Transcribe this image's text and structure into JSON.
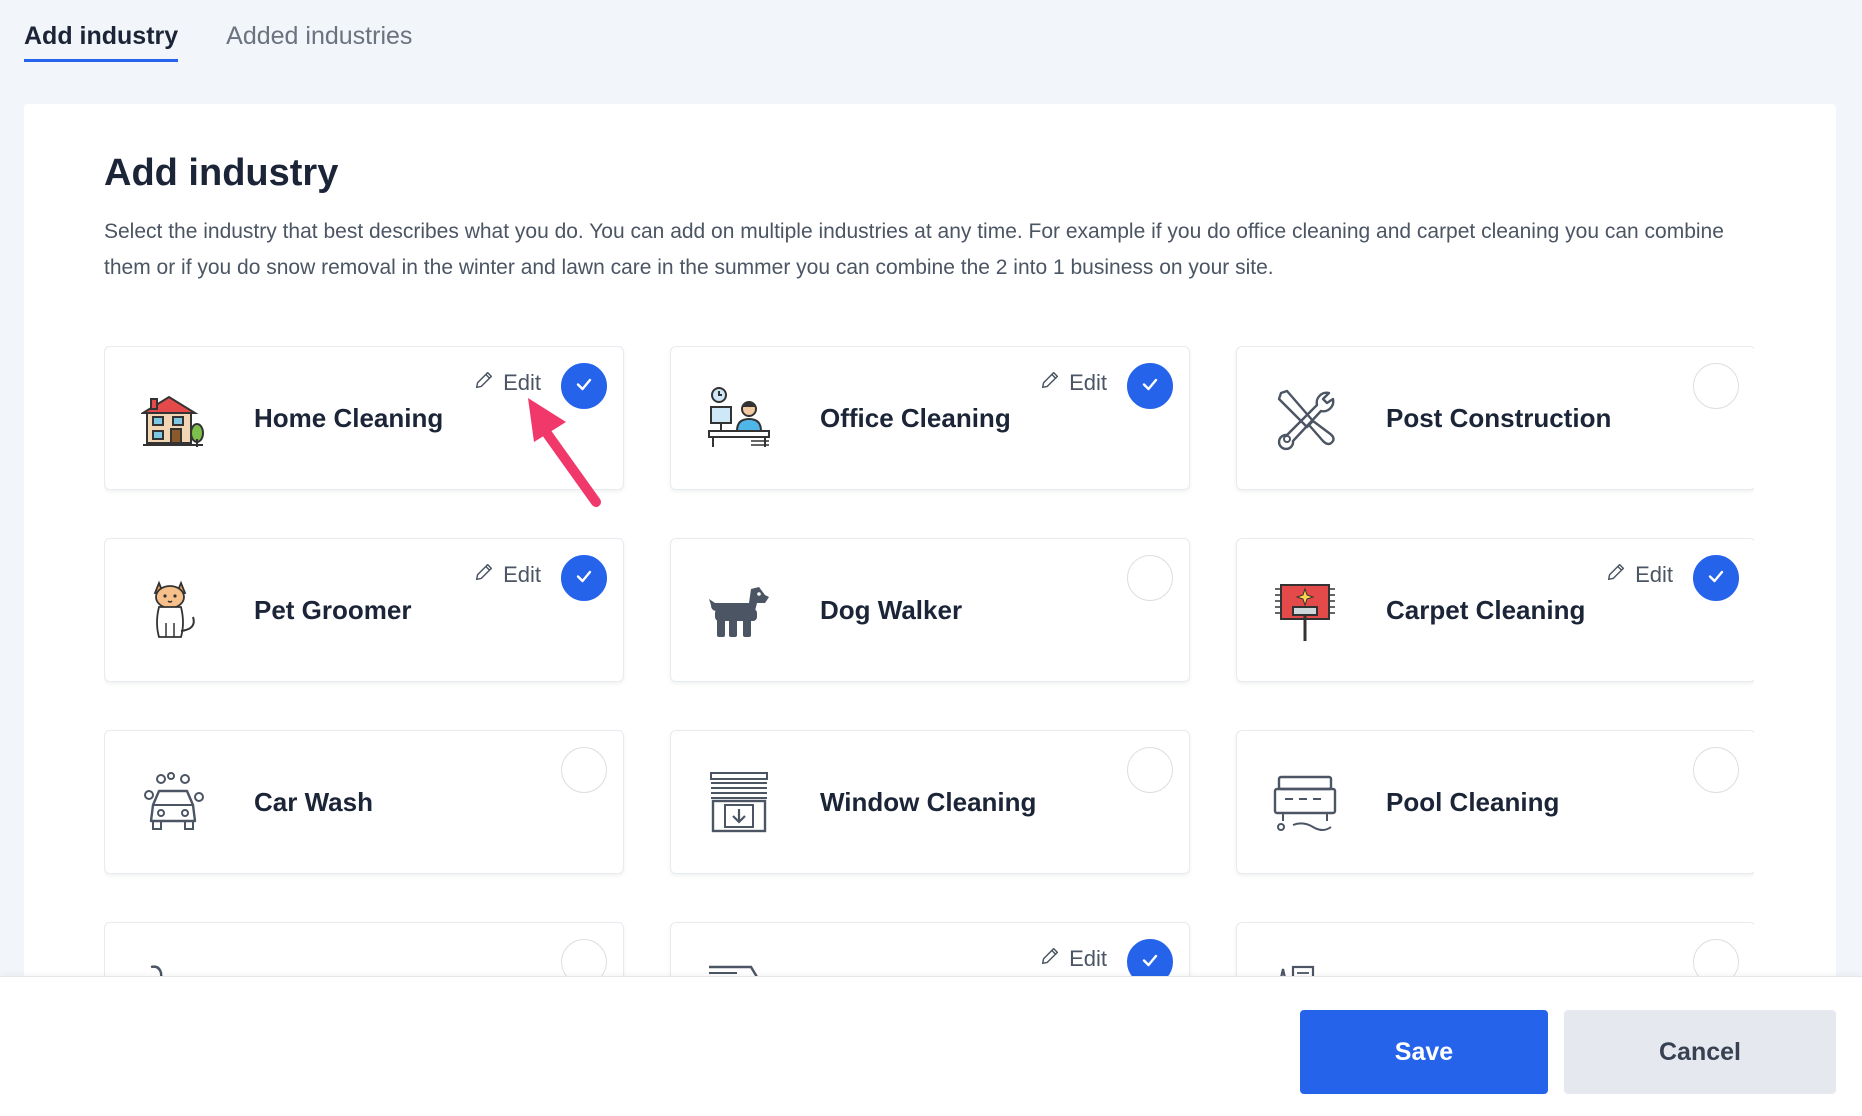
{
  "tabs": [
    {
      "label": "Add industry",
      "active": true
    },
    {
      "label": "Added industries",
      "active": false
    }
  ],
  "panel": {
    "title": "Add industry",
    "description": "Select the industry that best describes what you do. You can add on multiple industries at any time. For example if you do office cleaning and carpet cleaning you can combine them or if you do snow removal in the winter and lawn care in the summer you can combine the 2 into 1 business on your site."
  },
  "edit_label": "Edit",
  "industries": [
    {
      "name": "Home Cleaning",
      "icon": "house-icon",
      "selected": true
    },
    {
      "name": "Office Cleaning",
      "icon": "office-worker-icon",
      "selected": true
    },
    {
      "name": "Post Construction",
      "icon": "wrench-screwdriver-icon",
      "selected": false
    },
    {
      "name": "Pet Groomer",
      "icon": "cat-icon",
      "selected": true
    },
    {
      "name": "Dog Walker",
      "icon": "dog-icon",
      "selected": false
    },
    {
      "name": "Carpet Cleaning",
      "icon": "carpet-vacuum-icon",
      "selected": true
    },
    {
      "name": "Car Wash",
      "icon": "car-wash-icon",
      "selected": false
    },
    {
      "name": "Window Cleaning",
      "icon": "window-blinds-icon",
      "selected": false
    },
    {
      "name": "Pool Cleaning",
      "icon": "pool-icon",
      "selected": false
    },
    {
      "name": "",
      "icon": "hose-icon",
      "selected": false
    },
    {
      "name": "",
      "icon": "truck-icon",
      "selected": true
    },
    {
      "name": "",
      "icon": "sign-icon",
      "selected": false
    }
  ],
  "footer": {
    "save_label": "Save",
    "cancel_label": "Cancel"
  },
  "colors": {
    "accent": "#2563eb",
    "annotation": "#f0386b"
  }
}
